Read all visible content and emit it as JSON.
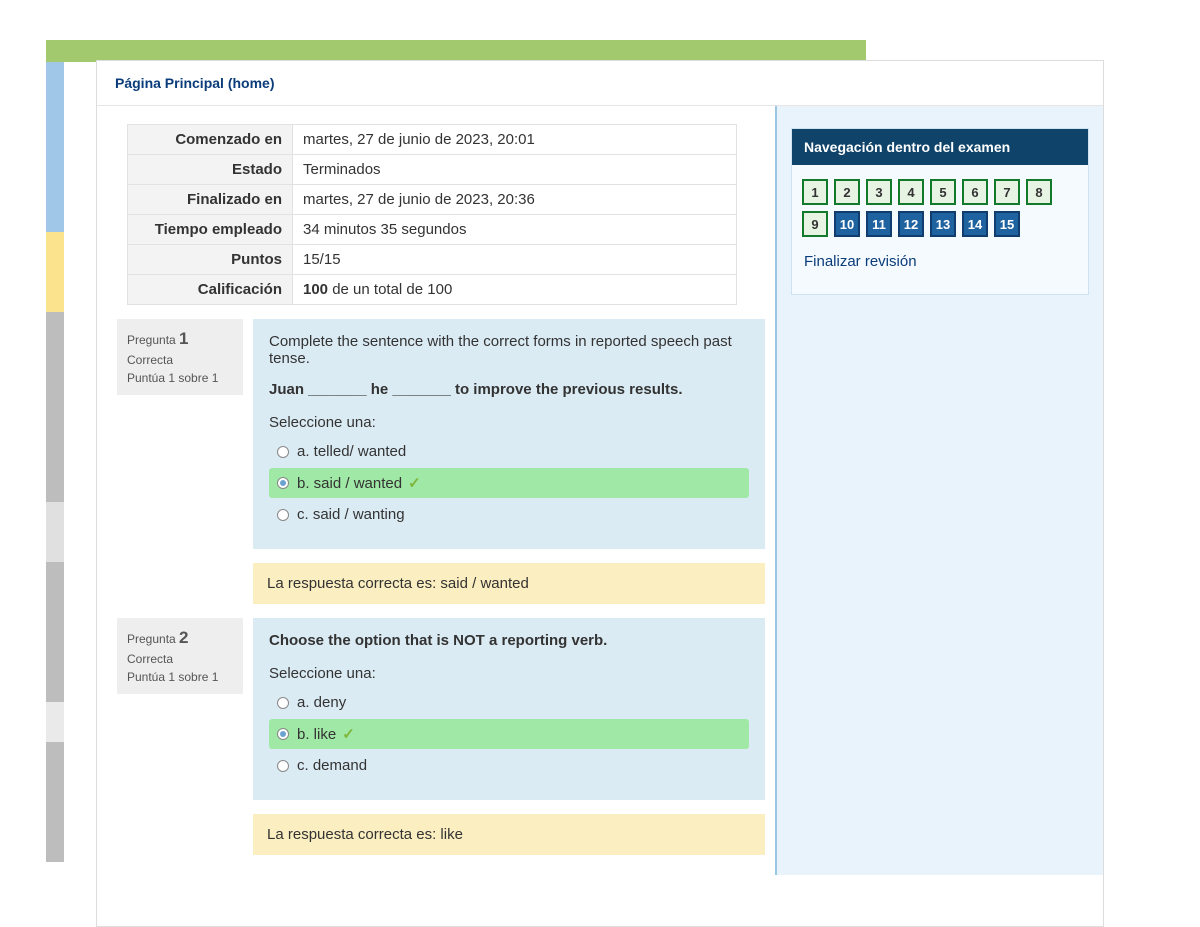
{
  "breadcrumb": "Página Principal (home)",
  "summary": {
    "rows": [
      {
        "label": "Comenzado en",
        "value": "martes, 27 de junio de 2023, 20:01"
      },
      {
        "label": "Estado",
        "value": "Terminados"
      },
      {
        "label": "Finalizado en",
        "value": "martes, 27 de junio de 2023, 20:36"
      },
      {
        "label": "Tiempo empleado",
        "value": "34 minutos 35 segundos"
      },
      {
        "label": "Puntos",
        "value": "15/15"
      },
      {
        "label": "Calificación",
        "value": "100 de un total de 100"
      }
    ]
  },
  "questions": [
    {
      "number": "1",
      "prefix": "Pregunta",
      "status": "Correcta",
      "points": "Puntúa 1 sobre 1",
      "prompt": "Complete the sentence with the correct forms in reported speech past tense.",
      "stem": "Juan _______ he _______ to improve the previous results.",
      "select_one": "Seleccione una:",
      "answers": [
        {
          "text": "a. telled/ wanted",
          "selected": false,
          "correct": false
        },
        {
          "text": "b. said / wanted",
          "selected": true,
          "correct": true
        },
        {
          "text": "c. said / wanting",
          "selected": false,
          "correct": false
        }
      ],
      "feedback": "La respuesta correcta es: said / wanted"
    },
    {
      "number": "2",
      "prefix": "Pregunta",
      "status": "Correcta",
      "points": "Puntúa 1 sobre 1",
      "prompt": "",
      "stem": "Choose the option that is NOT a reporting verb.",
      "select_one": "Seleccione una:",
      "answers": [
        {
          "text": "a. deny",
          "selected": false,
          "correct": false
        },
        {
          "text": "b. like",
          "selected": true,
          "correct": true
        },
        {
          "text": "c. demand",
          "selected": false,
          "correct": false
        }
      ],
      "feedback": "La respuesta correcta es: like"
    }
  ],
  "nav": {
    "title": "Navegación dentro del examen",
    "items": [
      "1",
      "2",
      "3",
      "4",
      "5",
      "6",
      "7",
      "8",
      "9",
      "10",
      "11",
      "12",
      "13",
      "14",
      "15"
    ],
    "finish": "Finalizar revisión"
  },
  "stripe_colors": [
    "#a3c96e",
    "#a1c7e8",
    "#fbe38e",
    "#bdbdbd",
    "#e0e0e0",
    "#bdbdbd",
    "#eaeaea",
    "#bdbdbd"
  ]
}
